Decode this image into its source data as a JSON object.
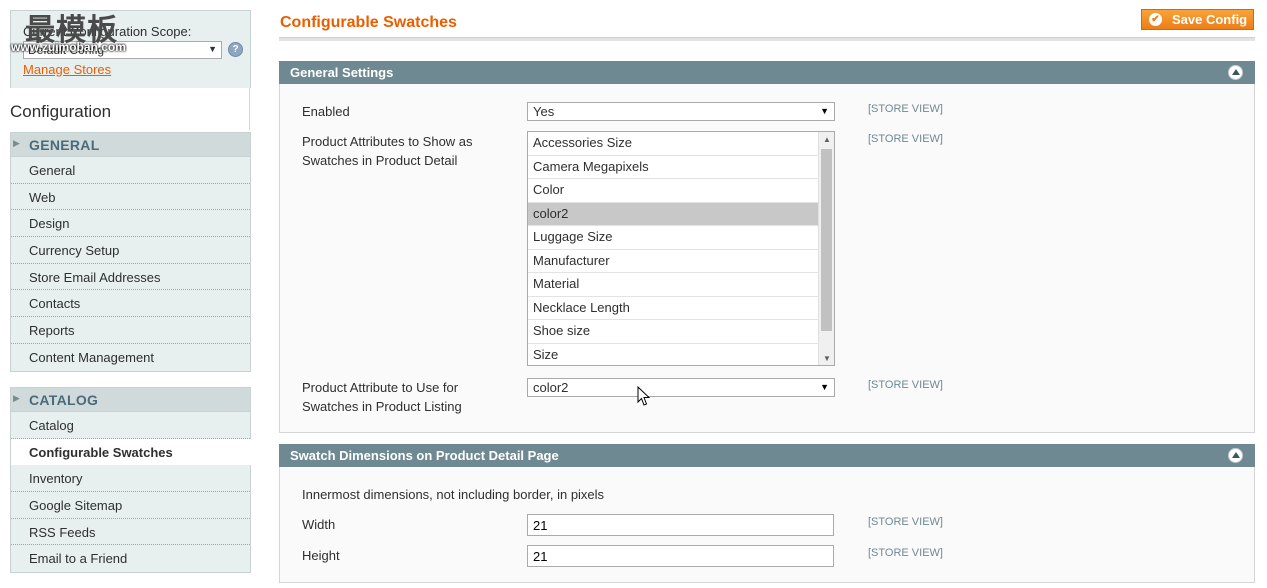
{
  "sidebar": {
    "scope_label": "Current Configuration Scope:",
    "scope_value": "Default Config",
    "manage_stores": "Manage Stores",
    "heading": "Configuration",
    "watermark": "最模板",
    "watermark_url": "www.zuimoban.com",
    "sections": [
      {
        "title": "GENERAL",
        "items": [
          "General",
          "Web",
          "Design",
          "Currency Setup",
          "Store Email Addresses",
          "Contacts",
          "Reports",
          "Content Management"
        ]
      },
      {
        "title": "CATALOG",
        "items": [
          "Catalog",
          "Configurable Swatches",
          "Inventory",
          "Google Sitemap",
          "RSS Feeds",
          "Email to a Friend"
        ]
      }
    ],
    "active_item": "Configurable Swatches"
  },
  "main": {
    "title": "Configurable Swatches",
    "save_button": "Save Config",
    "general": {
      "heading": "General Settings",
      "enabled_label": "Enabled",
      "enabled_value": "Yes",
      "attrs_label_1": "Product Attributes to Show as",
      "attrs_label_2": "Swatches in Product Detail",
      "attrs_options": [
        "Accessories Size",
        "Camera Megapixels",
        "Color",
        "color2",
        "Luggage Size",
        "Manufacturer",
        "Material",
        "Necklace Length",
        "Shoe size",
        "Size"
      ],
      "attrs_selected": "color2",
      "listing_label_1": "Product Attribute to Use for",
      "listing_label_2": "Swatches in Product Listing",
      "listing_value": "color2",
      "scope_tag": "[STORE VIEW]"
    },
    "dimensions": {
      "heading": "Swatch Dimensions on Product Detail Page",
      "note": "Innermost dimensions, not including border, in pixels",
      "width_label": "Width",
      "width_value": "21",
      "height_label": "Height",
      "height_value": "21",
      "scope_tag": "[STORE VIEW]"
    }
  },
  "colors": {
    "accent": "#eb5e00",
    "header_bar": "#6f8992",
    "sidebar_bg": "#e7efef"
  }
}
